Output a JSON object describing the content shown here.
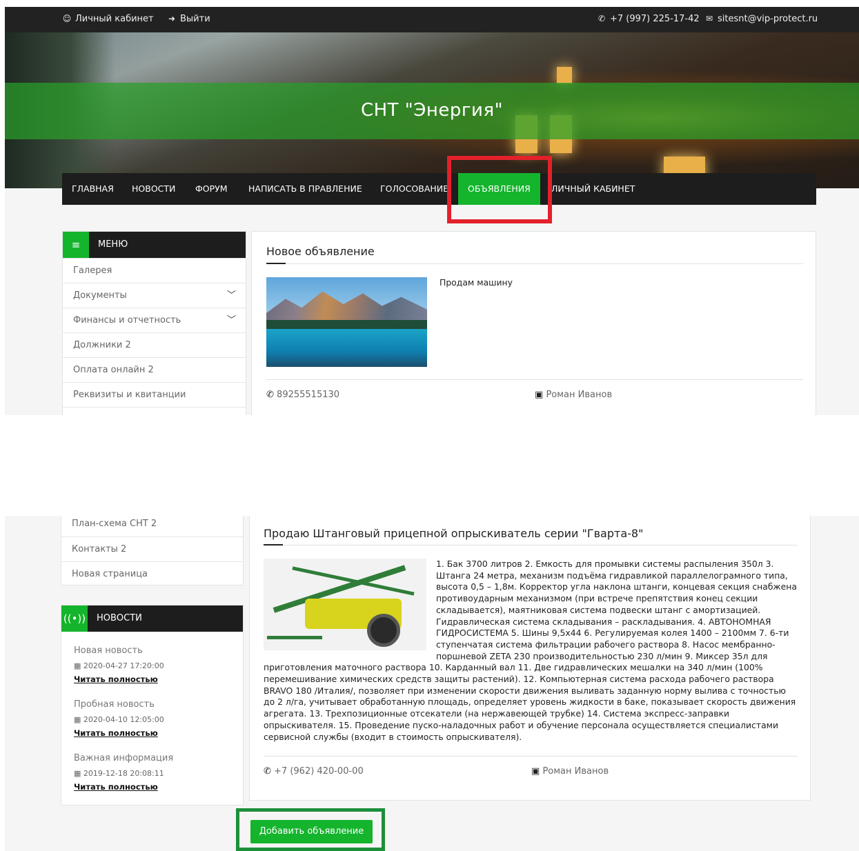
{
  "topbar": {
    "account_label": "Личный кабинет",
    "logout_label": "Выйти",
    "phone": "+7 (997) 225-17-42",
    "email": "sitesnt@vip-protect.ru"
  },
  "site": {
    "title": "СНТ \"Энергия\""
  },
  "nav": {
    "items": [
      "ГЛАВНАЯ",
      "НОВОСТИ",
      "ФОРУМ",
      "НАПИСАТЬ В ПРАВЛЕНИЕ",
      "ГОЛОСОВАНИЕ",
      "ОБЪЯВЛЕНИЯ",
      "ЛИЧНЫЙ КАБИНЕТ"
    ],
    "active": "ОБЪЯВЛЕНИЯ"
  },
  "sidebar": {
    "menu_title": "МЕНЮ",
    "items": [
      "Галерея",
      "Документы",
      "Финансы и отчетность",
      "Должники 2",
      "Оплата онлайн 2",
      "Реквизиты и квитанции",
      "План-схема СНТ 2",
      "Контакты 2",
      "Новая страница"
    ],
    "news_title": "НОВОСТИ",
    "news": [
      {
        "title": "Новая новость",
        "date": "2020-04-27 17:20:00",
        "link": "Читать полностью"
      },
      {
        "title": "Пробная новость",
        "date": "2020-04-10 12:05:00",
        "link": "Читать полностью"
      },
      {
        "title": "Важная информация",
        "date": "2019-12-18 20:08:11",
        "link": "Читать полностью"
      }
    ]
  },
  "ads": [
    {
      "title": "Новое объявление",
      "text": "Продам машину",
      "phone": "89255515130",
      "author": "Роман Иванов",
      "image": "mountain-lake-photo"
    },
    {
      "title": "Продаю Штанговый прицепной опрыскиватель серии \"Гварта-8\"",
      "text": "1. Бак 3700 литров 2. Емкость для промывки системы распыления 350л 3. Штанга 24 метра, механизм подъёма гидравликой параллелограмного типа, высота 0,5 – 1,8м. Корректор угла наклона штанги, концевая секция снабжена противоударным механизмом (при встрече препятствия конец секции складывается), маятниковая система подвески штанг с амортизацией. Гидравлическая система складывания – раскладывания. 4. АВТОНОМНАЯ ГИДРОСИСТЕМА 5. Шины 9,5х44 6. Регулируемая колея 1400 – 2100мм 7. 6-ти ступенчатая система фильтрации рабочего раствора 8. Насос мембранно-поршневой ZETA 230 производительностью 230 л/мин 9. Миксер 35л для приготовления маточного раствора 10. Карданный вал 11. Две гидравлических мешалки на 340 л/мин (100% перемешивание химических средств защиты растений). 12. Компьютерная система расхода рабочего раствора BRAVO 180 /Италия/, позволяет при изменении скорости движения выливать заданную норму вылива с точностью до 2 л/га, учитывает обработанную площадь, определяет уровень жидкости в баке, показывает скорость движения агрегата. 13. Трехпозиционные отсекатели (на нержавеющей трубке) 14. Система экспресс-заправки опрыскивателя. 15. Проведение пуско-наладочных работ и обучение персонала осуществляется специалистами сервисной службы (входит в стоимость опрыскивателя).",
      "phone": "+7 (962) 420-00-00",
      "author": "Роман Иванов",
      "image": "sprayer-photo"
    }
  ],
  "add_button": "Добавить объявление",
  "colors": {
    "accent": "#14b42c",
    "dark": "#1d1d1d",
    "highlight_red": "#e3212b",
    "highlight_green": "#1d8f3a"
  }
}
